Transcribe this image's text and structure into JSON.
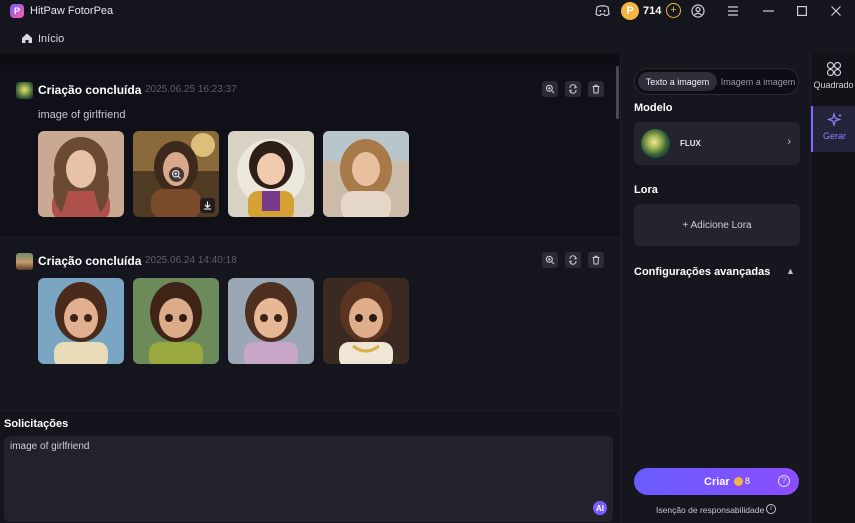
{
  "app": {
    "title": "HitPaw FotorPea",
    "logo_letter": "P"
  },
  "titlebar": {
    "coin_symbol": "P",
    "coins": "714",
    "coin_add": "+"
  },
  "nav": {
    "home_label": "Início"
  },
  "feed": {
    "cards": [
      {
        "title": "Criação concluída",
        "date": "2025.06.25  16:23:37",
        "prompt": "image of girlfriend"
      },
      {
        "title": "Criação concluída",
        "date": "2025.06.24  14:40:18"
      }
    ]
  },
  "prompt": {
    "heading": "Solicitações",
    "value": "image of girlfriend",
    "ai_label": "AI"
  },
  "panel": {
    "tabs": [
      "Texto a imagem",
      "Imagem a imagem"
    ],
    "model_heading": "Modelo",
    "model_name": "FLUX",
    "lora_heading": "Lora",
    "lora_button": "+ Adicione Lora",
    "advanced_heading": "Configurações avançadas",
    "create_label": "Criar",
    "create_cost": "8",
    "disclaimer": "Isenção de responsabilidade"
  },
  "rail": {
    "items": [
      {
        "label": "Quadrado"
      },
      {
        "label": "Gerar"
      }
    ]
  },
  "colors": {
    "accent": "#7b5cff",
    "coin": "#f3b445",
    "background": "#0d0d14"
  }
}
